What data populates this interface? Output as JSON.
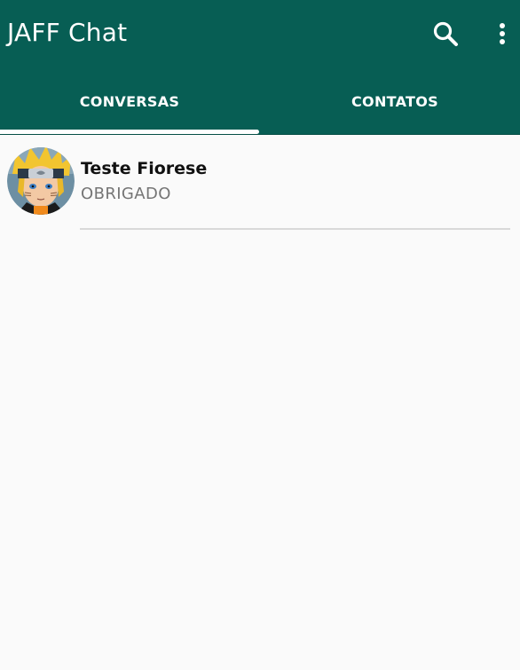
{
  "app": {
    "title": "JAFF Chat",
    "accent_color": "#075e54"
  },
  "toolbar": {
    "search_icon": "search-icon",
    "menu_icon": "more-vert-icon"
  },
  "tabs": [
    {
      "label": "CONVERSAS",
      "selected": true
    },
    {
      "label": "CONTATOS",
      "selected": false
    }
  ],
  "conversations": [
    {
      "name": "Teste Fiorese",
      "last_message": "OBRIGADO",
      "avatar_icon": "anime-avatar-image"
    }
  ]
}
